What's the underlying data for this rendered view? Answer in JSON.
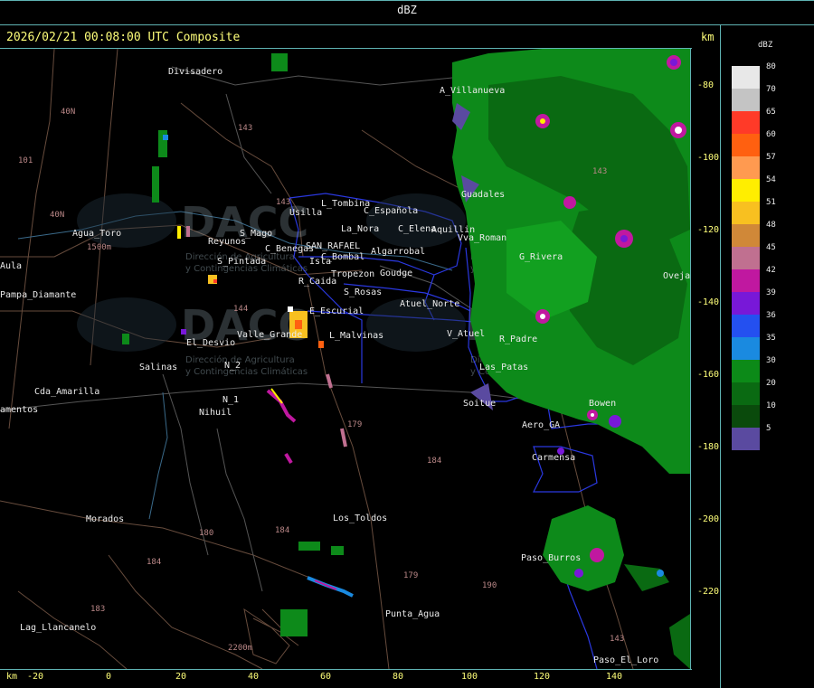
{
  "header": {
    "title": "dBZ"
  },
  "map": {
    "subtitle": "2026/02/21 00:08:00 UTC Composite",
    "km_label": "km",
    "y_ticks": [
      "-80",
      "-100",
      "-120",
      "-140",
      "-160",
      "-180",
      "-200",
      "-220"
    ],
    "x_ticks": [
      "-20",
      "0",
      "20",
      "40",
      "60",
      "80",
      "100",
      "120",
      "140"
    ],
    "places": [
      "Divisadero",
      "A_Villanueva",
      "Guadales",
      "Usilla",
      "L_Tombina",
      "C_Española",
      "La_Nora",
      "C_Elena",
      "Aquillin",
      "Vva_Roman",
      "Agua_Toro",
      "Reyunos",
      "S_Mago",
      "C_Benegas",
      "SAN_RAFAEL",
      "C_Bombal",
      "Algarrobal",
      "Isla",
      "S_Pintada",
      "Tropezon",
      "Goudge",
      "R_Caida",
      "S_Rosas",
      "Pampa_Diamante",
      "E_Escurial",
      "Atuel_Norte",
      "Valle_Grande",
      "El_Desvio",
      "L_Malvinas",
      "V_Atuel",
      "R_Padre",
      "Salinas",
      "N_2",
      "N_1",
      "Nihuil",
      "Cda_Amarilla",
      "Soitue",
      "Aero_GA",
      "Carmensa",
      "Los_Toldos",
      "Morados",
      "Paso_Burros",
      "Punta_Agua",
      "Lag_Llancanelo",
      "Paso_El_Loro",
      "Bowen",
      "Aula",
      "amentos",
      "G_Rivera",
      "Ovejas",
      "Las_Patas"
    ],
    "road_labels": [
      "143",
      "143",
      "101",
      "40N",
      "40N",
      "144",
      "179",
      "184",
      "180",
      "184",
      "183",
      "184",
      "179",
      "190",
      "143",
      "1500m",
      "2200m",
      "143"
    ],
    "watermark": {
      "brand": "DACC",
      "line1": "Dirección de Agricultura",
      "line2": "y Contingencias Climáticas"
    }
  },
  "legend": {
    "title": "dBZ",
    "items": [
      {
        "label": "80",
        "color": "#e8e8e8"
      },
      {
        "label": "70",
        "color": "#c4c4c4"
      },
      {
        "label": "65",
        "color": "#ff3a28"
      },
      {
        "label": "60",
        "color": "#ff6010"
      },
      {
        "label": "57",
        "color": "#ff9a50"
      },
      {
        "label": "54",
        "color": "#ffee00"
      },
      {
        "label": "51",
        "color": "#f8c020"
      },
      {
        "label": "48",
        "color": "#d08838"
      },
      {
        "label": "45",
        "color": "#c07090"
      },
      {
        "label": "42",
        "color": "#c018a0"
      },
      {
        "label": "39",
        "color": "#7818d8"
      },
      {
        "label": "36",
        "color": "#2450f0"
      },
      {
        "label": "35",
        "color": "#1a8ae0"
      },
      {
        "label": "30",
        "color": "#0c8a18"
      },
      {
        "label": "20",
        "color": "#0a6a12"
      },
      {
        "label": "10",
        "color": "#0a4a0c"
      },
      {
        "label": "5",
        "color": "#5a4aa0"
      }
    ]
  }
}
